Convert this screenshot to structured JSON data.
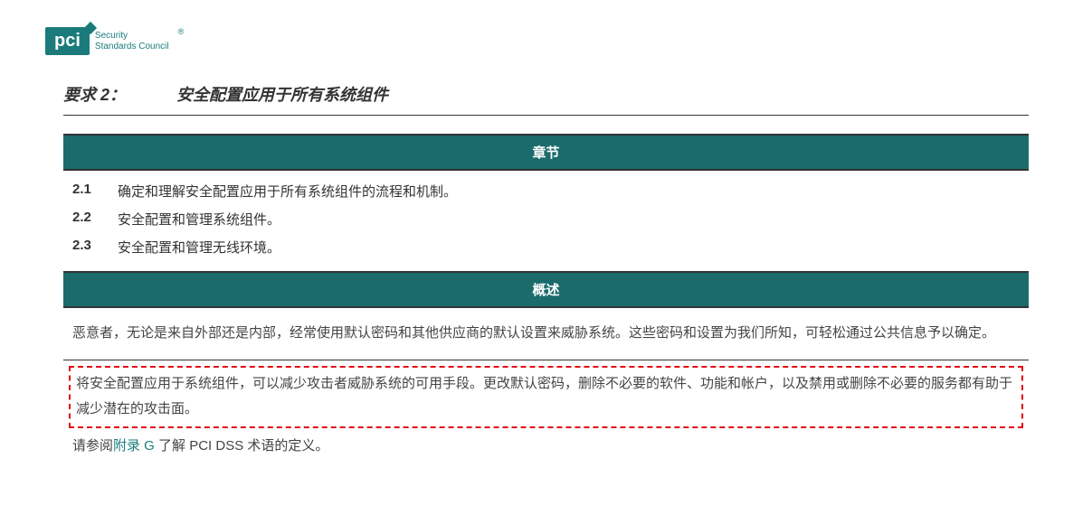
{
  "logo": {
    "brand": "pci",
    "line1": "Security",
    "line2": "Standards Council",
    "mark": "®"
  },
  "requirement": {
    "label": "要求 2：",
    "title": "安全配置应用于所有系统组件"
  },
  "sections_header": "章节",
  "sections": [
    {
      "num": "2.1",
      "text": "确定和理解安全配置应用于所有系统组件的流程和机制。"
    },
    {
      "num": "2.2",
      "text": "安全配置和管理系统组件。"
    },
    {
      "num": "2.3",
      "text": "安全配置和管理无线环境。"
    }
  ],
  "overview_header": "概述",
  "overview_p1": "恶意者，无论是来自外部还是内部，经常使用默认密码和其他供应商的默认设置来威胁系统。这些密码和设置为我们所知，可轻松通过公共信息予以确定。",
  "highlight": "将安全配置应用于系统组件，可以减少攻击者威胁系统的可用手段。更改默认密码，删除不必要的软件、功能和帐户，以及禁用或删除不必要的服务都有助于减少潜在的攻击面。",
  "footer": {
    "prefix": "请参阅",
    "link": "附录 G",
    "suffix": " 了解 PCI DSS 术语的定义。"
  }
}
